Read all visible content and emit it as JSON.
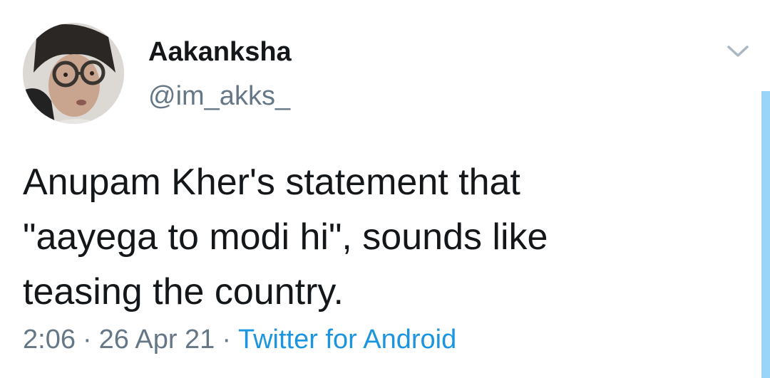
{
  "tweet": {
    "author": {
      "display_name": "Aakanksha",
      "handle": "@im_akks_",
      "avatar_icon": "profile-photo"
    },
    "text_lines": [
      "Anupam Kher's statement that",
      "\"aayega to modi hi\", sounds like",
      "teasing the country."
    ],
    "time": "2:06",
    "date": "26 Apr 21",
    "separator": "·",
    "source": "Twitter for Android",
    "menu_icon": "chevron-down-icon"
  },
  "colors": {
    "text_primary": "#14171a",
    "text_secondary": "#657786",
    "link": "#1b95e0",
    "scroll_accent": "#1da1f2"
  }
}
